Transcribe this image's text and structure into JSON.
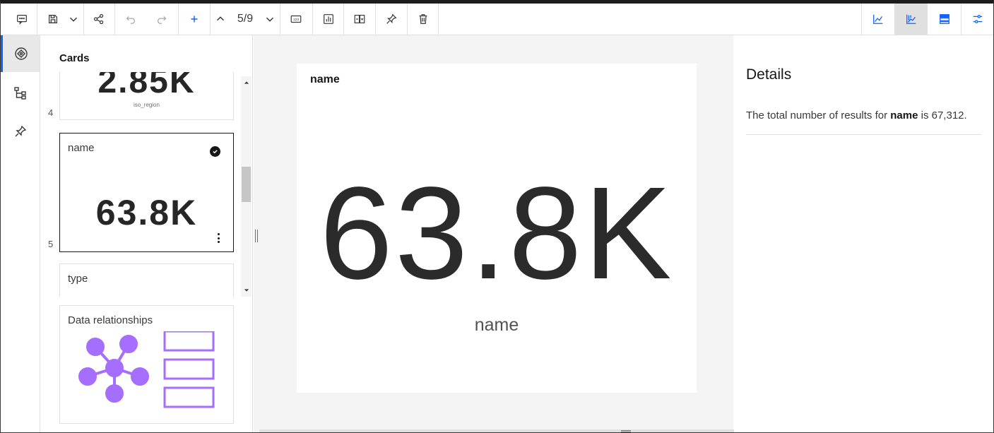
{
  "toolbar": {
    "left_icons": [
      "comment-icon",
      "save-icon",
      "chevron-down-icon",
      "share-icon",
      "undo-icon",
      "redo-icon",
      "add-icon",
      "chevron-up-icon"
    ],
    "pager_text": "5/9",
    "right_group_icons": [
      "chevron-down-icon",
      "number-card-icon",
      "chart-card-icon",
      "compare-icon",
      "pin-icon",
      "delete-icon"
    ],
    "view_icons": [
      "line-chart-icon",
      "explore-chart-icon",
      "data-table-icon",
      "settings-adjust-icon"
    ],
    "accent_color": "#0f62fe"
  },
  "rail": {
    "items": [
      "insights-icon",
      "hierarchy-icon",
      "pin-icon"
    ]
  },
  "cards_panel": {
    "title": "Cards",
    "cards": [
      {
        "number": "4",
        "value": "2.85K",
        "sub_label": "iso_region"
      },
      {
        "number": "5",
        "label": "name",
        "value": "63.8K",
        "selected": true
      },
      {
        "label": "type"
      },
      {
        "label": "Data relationships",
        "diagram_color": "#a56eff"
      }
    ]
  },
  "main": {
    "card_title": "name",
    "big_value": "63.8K",
    "value_label": "name"
  },
  "details": {
    "title": "Details",
    "text_prefix": "The total number of results for ",
    "text_field": "name",
    "text_middle": " is ",
    "text_value": "67,312."
  }
}
